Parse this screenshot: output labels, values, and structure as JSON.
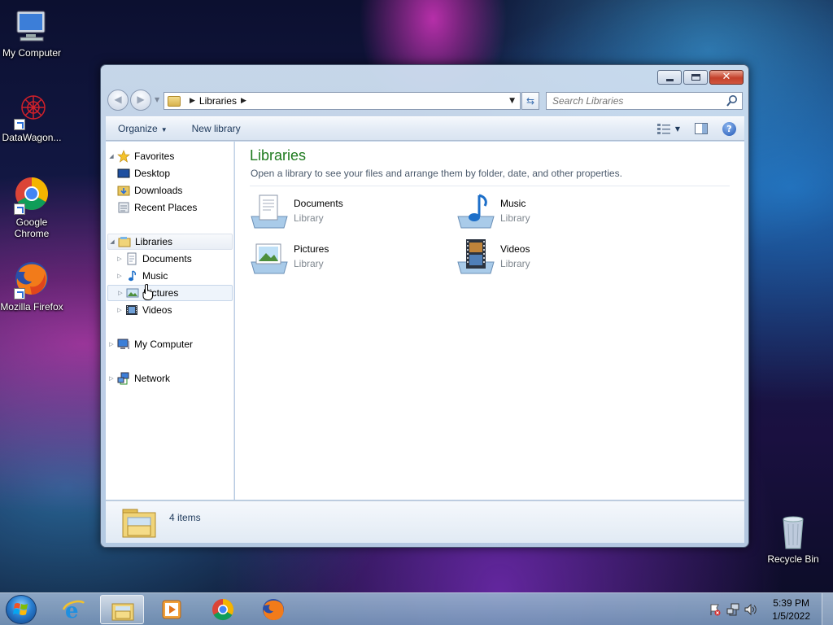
{
  "desktop": {
    "icons": [
      {
        "label": "My Computer"
      },
      {
        "label": "DataWagon..."
      },
      {
        "label": "Google Chrome"
      },
      {
        "label": "Mozilla Firefox"
      },
      {
        "label": "Recycle Bin"
      }
    ]
  },
  "window": {
    "address": {
      "crumb": "Libraries"
    },
    "search": {
      "placeholder": "Search Libraries"
    },
    "toolbar": {
      "organize": "Organize",
      "new_library": "New library"
    },
    "nav": {
      "favorites": "Favorites",
      "desktop": "Desktop",
      "downloads": "Downloads",
      "recent_places": "Recent Places",
      "libraries": "Libraries",
      "documents": "Documents",
      "music": "Music",
      "pictures": "Pictures",
      "videos": "Videos",
      "my_computer": "My Computer",
      "network": "Network"
    },
    "content": {
      "title": "Libraries",
      "subtitle": "Open a library to see your files and arrange them by folder, date, and other properties.",
      "items": [
        {
          "name": "Documents",
          "kind": "Library"
        },
        {
          "name": "Music",
          "kind": "Library"
        },
        {
          "name": "Pictures",
          "kind": "Library"
        },
        {
          "name": "Videos",
          "kind": "Library"
        }
      ]
    },
    "details": {
      "count": "4 items"
    }
  },
  "taskbar": {
    "clock": {
      "time": "5:39 PM",
      "date": "1/5/2022"
    }
  }
}
